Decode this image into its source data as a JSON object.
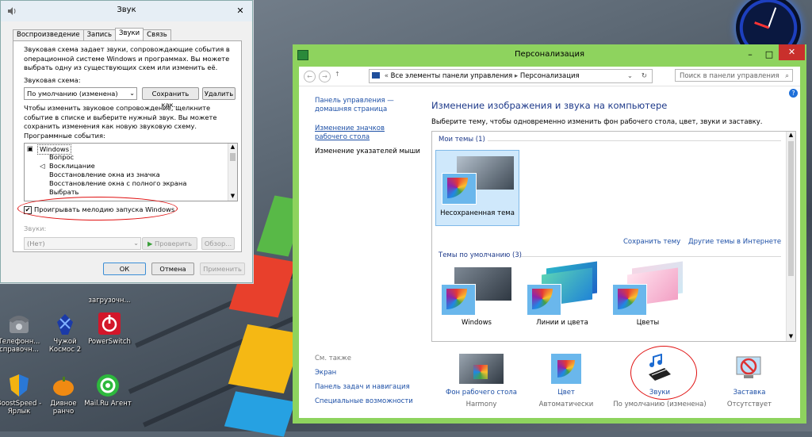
{
  "sound_dialog": {
    "title": "Звук",
    "tabs": [
      "Воспроизведение",
      "Запись",
      "Звуки",
      "Связь"
    ],
    "description": "Звуковая схема задает звуки, сопровождающие события в операционной системе Windows и программах. Вы можете выбрать одну из существующих схем или изменить её.",
    "scheme_label": "Звуковая схема:",
    "scheme_value": "По умолчанию (изменена)",
    "save_as_label": "Сохранить как...",
    "delete_label": "Удалить",
    "instructions": "Чтобы изменить звуковое сопровождение, щелкните событие в списке и выберите нужный звук. Вы можете сохранить изменения как новую звуковую схему.",
    "events_label": "Программные события:",
    "events": [
      "Windows",
      "Вопрос",
      "Восклицание",
      "Восстановление окна из значка",
      "Восстановление окна с полного экрана",
      "Выбрать"
    ],
    "startup_checkbox": "Проигрывать мелодию запуска Windows",
    "startup_checked": true,
    "sounds_label": "Звуки:",
    "sound_value": "(Нет)",
    "test_label": "Проверить",
    "browse_label": "Обзор...",
    "ok_label": "ОК",
    "cancel_label": "Отмена",
    "apply_label": "Применить"
  },
  "desktop": {
    "icons": [
      {
        "label": "загрузочн...",
        "icon": "app-icon"
      },
      {
        "label": "Телефонн... справочн...",
        "icon": "phone-icon"
      },
      {
        "label": "Чужой Космос 2",
        "icon": "alien-icon"
      },
      {
        "label": "PowerSwitch",
        "icon": "power-icon"
      },
      {
        "label": "BoostSpeed - Ярлык",
        "icon": "shield-icon"
      },
      {
        "label": "Дивное ранчо",
        "icon": "pumpkin-icon"
      },
      {
        "label": "Mail.Ru Агент",
        "icon": "mail-agent-icon"
      }
    ]
  },
  "personalization": {
    "title": "Персонализация",
    "breadcrumb": [
      "Все элементы панели управления",
      "Персонализация"
    ],
    "search_placeholder": "Поиск в панели управления",
    "left_nav": {
      "home": "Панель управления — домашняя страница",
      "desktop_icons": "Изменение значков рабочего стола",
      "mouse_pointers": "Изменение указателей мыши"
    },
    "see_also_label": "См. также",
    "see_also": [
      "Экран",
      "Панель задач и навигация",
      "Специальные возможности"
    ],
    "heading": "Изменение изображения и звука на компьютере",
    "subheading": "Выберите тему, чтобы одновременно изменить фон рабочего стола, цвет, звуки и заставку.",
    "my_themes_group": "Мои темы (1)",
    "unsaved_theme": "Несохраненная тема",
    "save_theme": "Сохранить тему",
    "more_themes": "Другие темы в Интернете",
    "default_themes_group": "Темы по умолчанию (3)",
    "default_themes": [
      "Windows",
      "Линии и цвета",
      "Цветы"
    ],
    "bottom": [
      {
        "title": "Фон рабочего стола",
        "value": "Harmony"
      },
      {
        "title": "Цвет",
        "value": "Автоматически"
      },
      {
        "title": "Звуки",
        "value": "По умолчанию (изменена)"
      },
      {
        "title": "Заставка",
        "value": "Отсутствует"
      }
    ],
    "window_bg": "#8ed35e",
    "close_color": "#c9302c"
  }
}
